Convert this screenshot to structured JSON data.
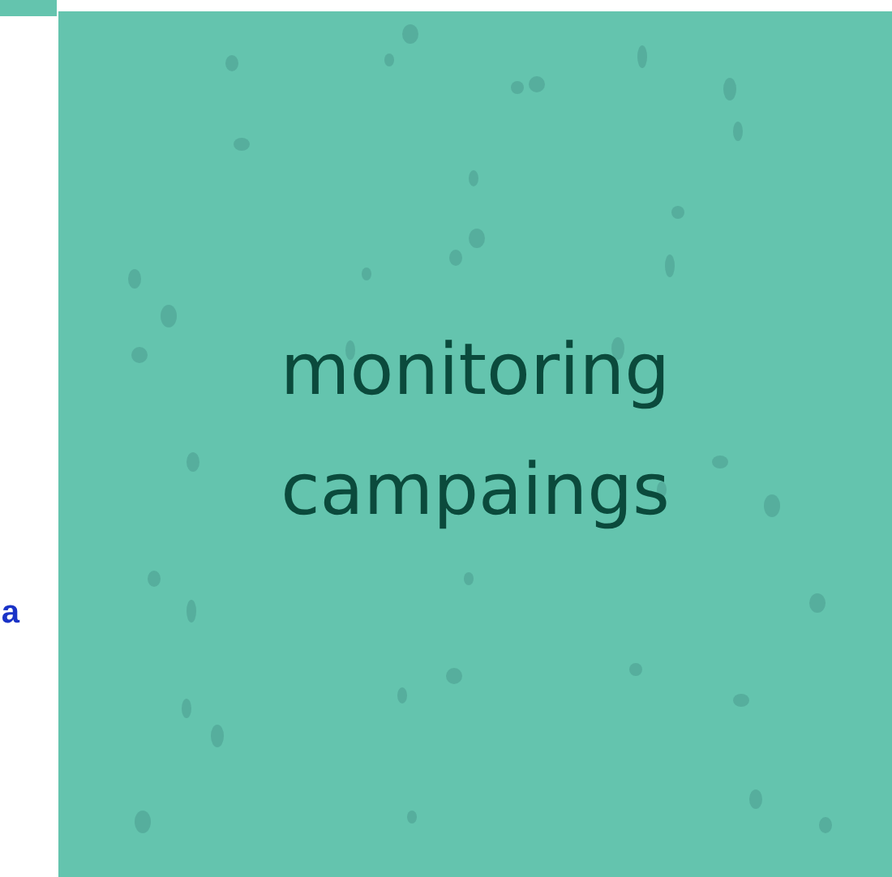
{
  "side_link": {
    "text": "a"
  },
  "tile": {
    "title": "monitoring campaings"
  }
}
